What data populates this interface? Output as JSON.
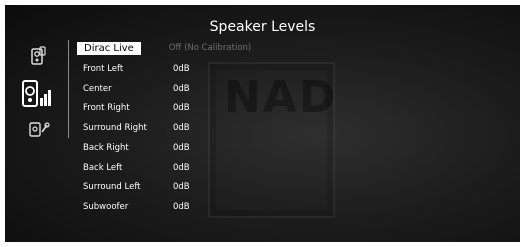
{
  "screen": {
    "title": "Speaker Levels",
    "watermark": "NAD"
  },
  "sidebar": {
    "icons": [
      "speaker-remote-icon",
      "speaker-levels-icon",
      "speaker-wrench-icon"
    ]
  },
  "levels": [
    {
      "label": "Dirac Live",
      "value": "Off (No Calibration)",
      "selected": true
    },
    {
      "label": "Front Left",
      "value": "0dB"
    },
    {
      "label": "Center",
      "value": "0dB"
    },
    {
      "label": "Front Right",
      "value": "0dB"
    },
    {
      "label": "Surround Right",
      "value": "0dB"
    },
    {
      "label": "Back Right",
      "value": "0dB"
    },
    {
      "label": "Back Left",
      "value": "0dB"
    },
    {
      "label": "Surround Left",
      "value": "0dB"
    },
    {
      "label": "Subwoofer",
      "value": "0dB"
    }
  ]
}
